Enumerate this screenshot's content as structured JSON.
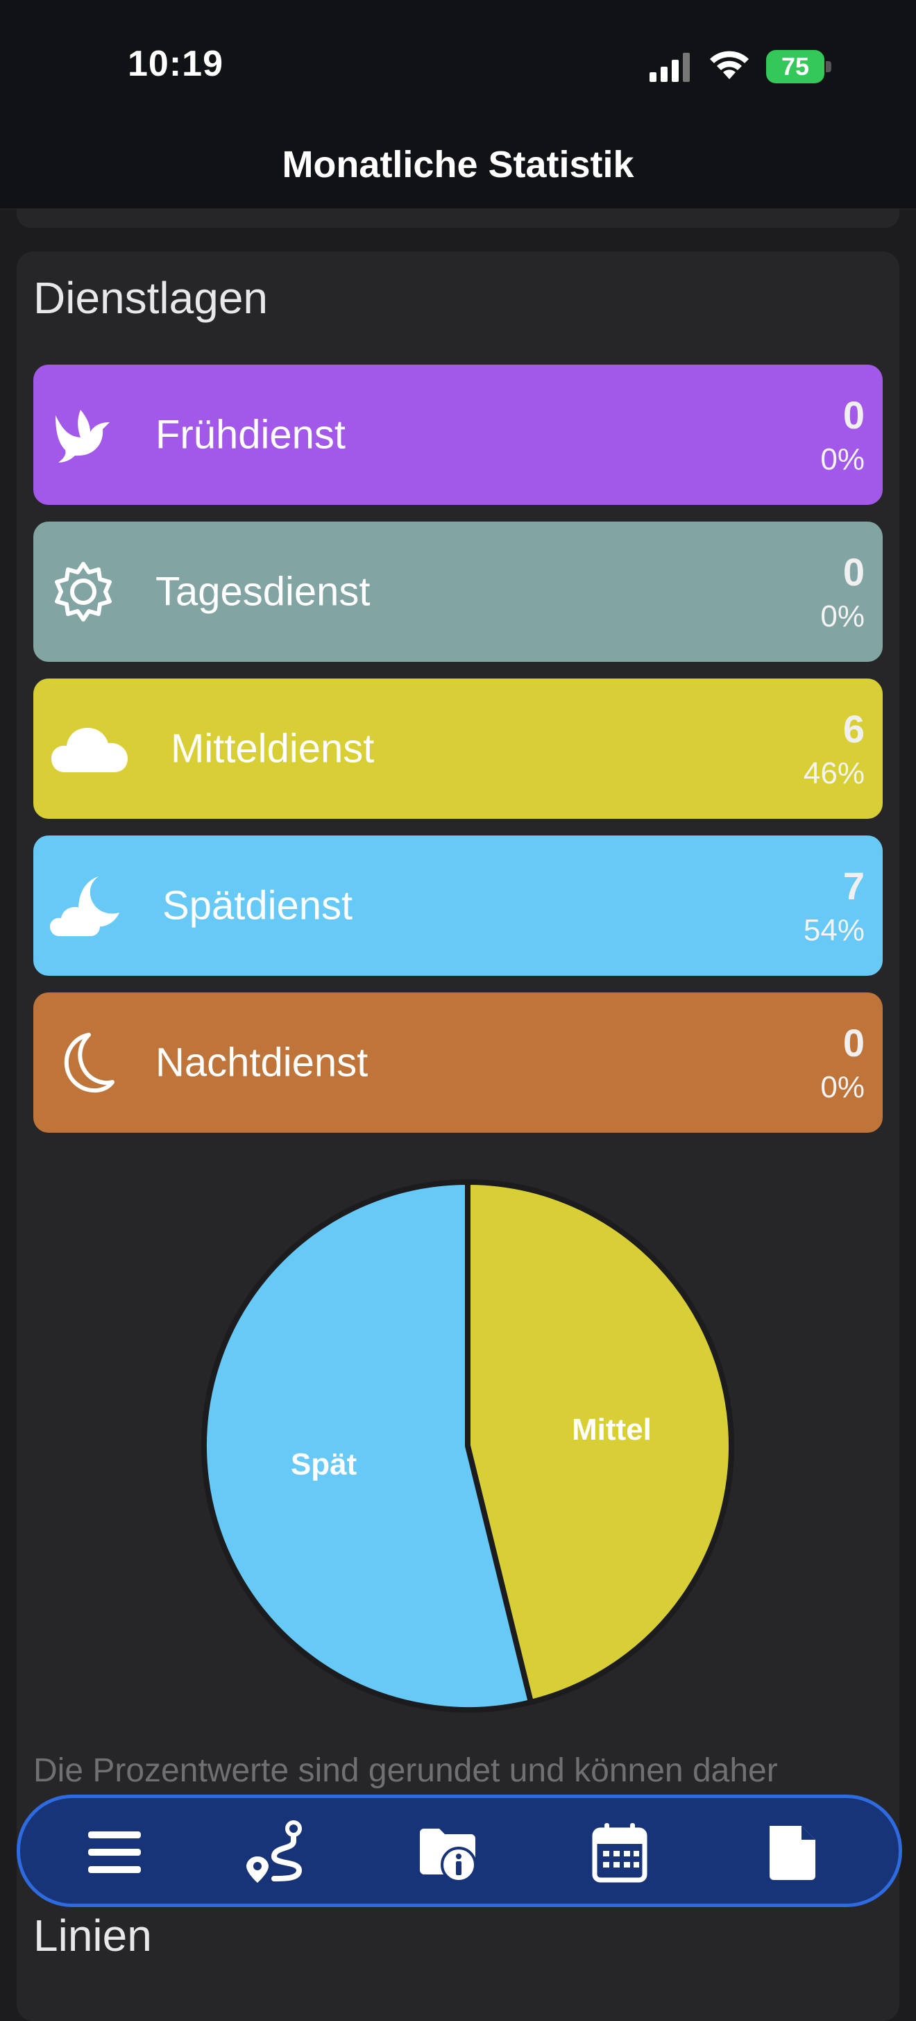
{
  "status": {
    "time": "10:19",
    "battery": "75"
  },
  "nav": {
    "title": "Monatliche Statistik"
  },
  "section": {
    "title": "Dienstlagen"
  },
  "shifts": [
    {
      "label": "Frühdienst",
      "count": "0",
      "percent": "0%",
      "color": "#a259ea",
      "icon": "dove-icon"
    },
    {
      "label": "Tagesdienst",
      "count": "0",
      "percent": "0%",
      "color": "#82a5a3",
      "icon": "sun-gear-icon"
    },
    {
      "label": "Mitteldienst",
      "count": "6",
      "percent": "46%",
      "color": "#d8cf37",
      "icon": "cloud-icon"
    },
    {
      "label": "Spätdienst",
      "count": "7",
      "percent": "54%",
      "color": "#66c9f6",
      "icon": "moon-cloud-icon"
    },
    {
      "label": "Nachtdienst",
      "count": "0",
      "percent": "0%",
      "color": "#bf7439",
      "icon": "moon-icon"
    }
  ],
  "chart_data": {
    "type": "pie",
    "slices": [
      {
        "label": "Mittel",
        "value": 6,
        "color": "#d8cf37"
      },
      {
        "label": "Spät",
        "value": 7,
        "color": "#66c9f6"
      }
    ]
  },
  "note": "Die Prozentwerte sind gerundet und können daher",
  "tabbar": {
    "items": [
      "menu-icon",
      "route-icon",
      "folder-info-icon",
      "calendar-icon",
      "document-icon"
    ]
  },
  "next_section": {
    "title": "Linien"
  }
}
